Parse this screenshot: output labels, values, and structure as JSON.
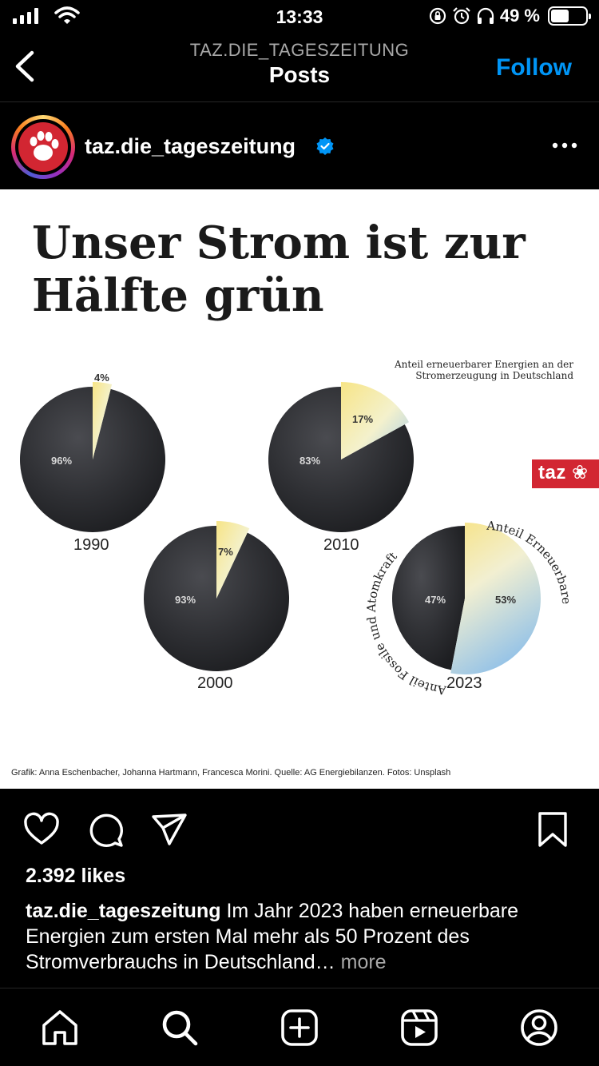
{
  "status": {
    "time": "13:33",
    "battery_text": "49 %"
  },
  "nav": {
    "account_caps": "TAZ.DIE_TAGESZEITUNG",
    "title": "Posts",
    "follow_label": "Follow"
  },
  "post": {
    "username": "taz.die_tageszeitung",
    "verified": true,
    "image": {
      "headline": "Unser Strom ist zur Hälfte grün",
      "subtitle": "Anteil erneuerbarer Energien an der Stromerzeugung in Deutschland",
      "ring_left": "Anteil Fossile und Atomkraft",
      "ring_right": "Anteil Erneuerbare",
      "logo": "taz",
      "credit": "Grafik: Anna Eschenbacher, Johanna Hartmann, Francesca Morini. Quelle: AG Energiebilanzen. Fotos: Unsplash"
    },
    "likes": "2.392 likes",
    "caption_text": "Im Jahr 2023 haben erneuerbare Energien zum ersten Mal mehr als 50 Prozent des Stromverbrauchs in Deutschland…",
    "caption_more": "more"
  },
  "colors": {
    "accent": "#0095f6",
    "brand_red": "#d22632",
    "fossil": "#2f3034",
    "renewable_yellow": "#f6e488",
    "renewable_blue": "#a9cde6"
  },
  "icons": {
    "actions": [
      "heart-icon",
      "comment-icon",
      "share-icon",
      "bookmark-icon"
    ],
    "tabs": [
      "home-icon",
      "search-icon",
      "create-icon",
      "reels-icon",
      "profile-icon"
    ]
  },
  "chart_data": {
    "type": "pie",
    "title": "Unser Strom ist zur Hälfte grün",
    "subtitle": "Anteil erneuerbarer Energien an der Stromerzeugung in Deutschland",
    "series": [
      {
        "year": "1990",
        "fossil_label": "96%",
        "renewable_label": "4%",
        "renewable": 4
      },
      {
        "year": "2000",
        "fossil_label": "93%",
        "renewable_label": "7%",
        "renewable": 7
      },
      {
        "year": "2010",
        "fossil_label": "83%",
        "renewable_label": "17%",
        "renewable": 17
      },
      {
        "year": "2023",
        "fossil_label": "47%",
        "renewable_label": "53%",
        "renewable": 53
      }
    ]
  }
}
